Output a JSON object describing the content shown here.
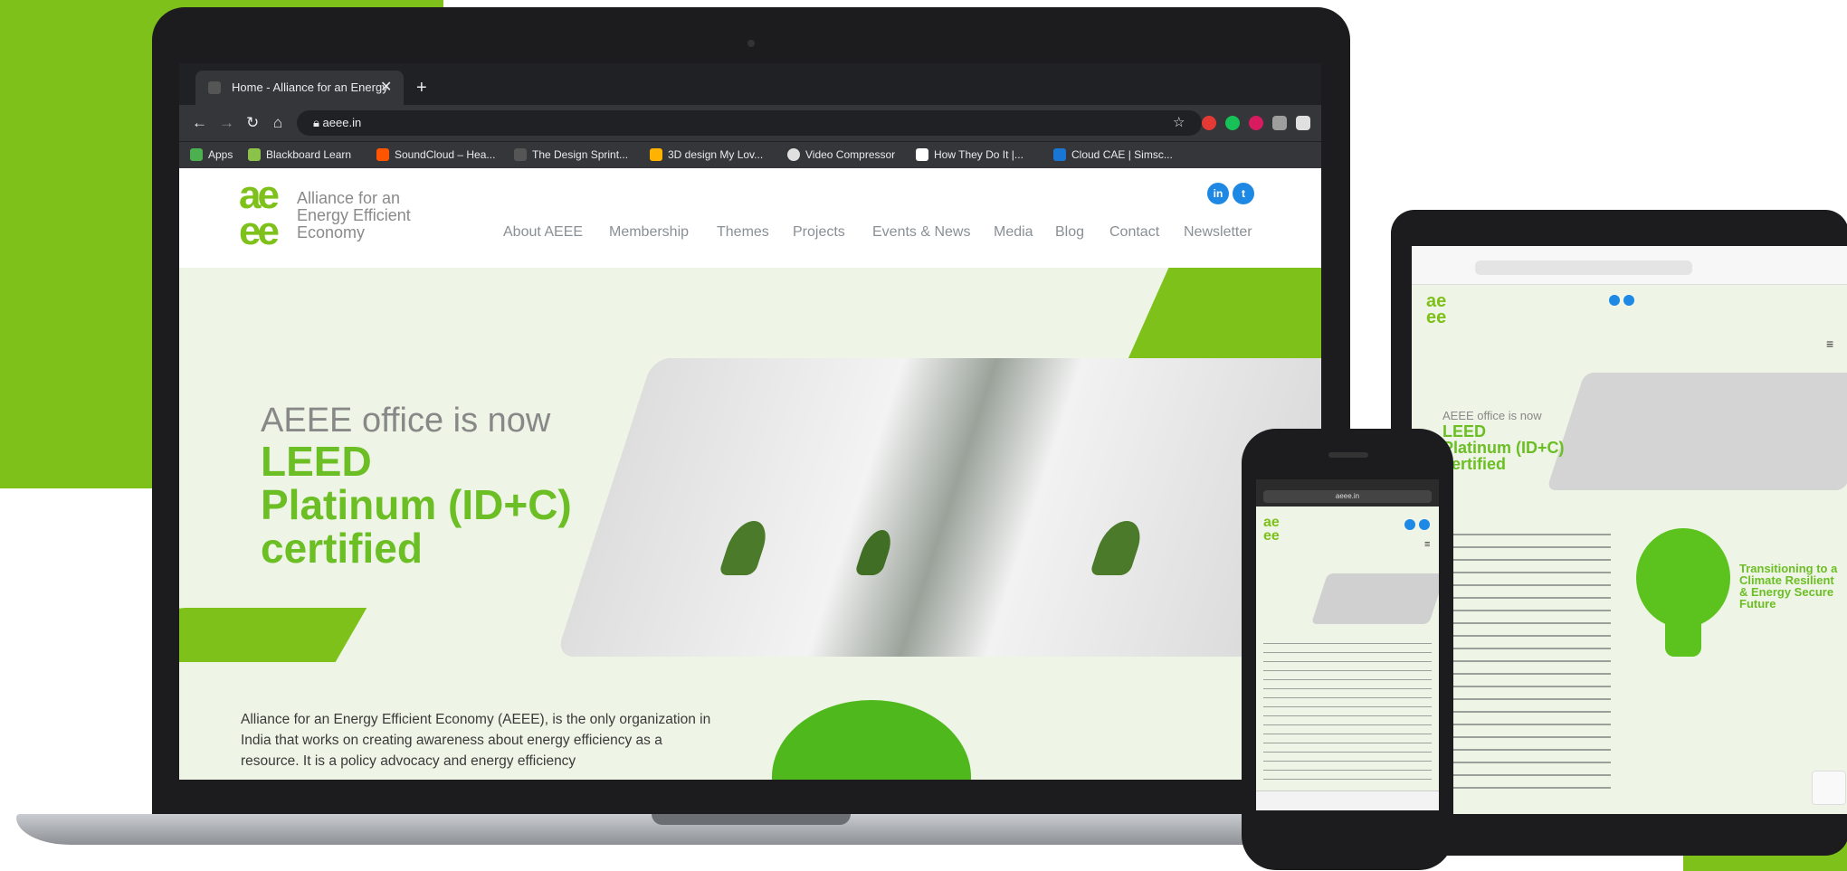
{
  "colors": {
    "brand_green": "#7ec11a",
    "heading_green": "#6cbe25",
    "chrome_dark": "#202124",
    "social_blue": "#1e88e5"
  },
  "browser": {
    "tab_title": "Home - Alliance for an Energy",
    "url": "aeee.in",
    "bookmarks": [
      "Apps",
      "Blackboard Learn",
      "SoundCloud – Hea...",
      "The Design Sprint...",
      "3D design My Lov...",
      "Video Compressor",
      "How They Do It |...",
      "Cloud CAE | Simsc..."
    ]
  },
  "site": {
    "logo_mark": "ae ee",
    "logo_text": [
      "Alliance for an",
      "Energy Efficient",
      "Economy"
    ],
    "social": [
      "in",
      "t"
    ],
    "menu": [
      "About AEEE",
      "Membership",
      "Themes",
      "Projects",
      "Events & News",
      "Media",
      "Blog",
      "Contact",
      "Newsletter"
    ],
    "hero_line1": "AEEE office is now",
    "hero_line2": "LEED",
    "hero_line3": "Platinum (ID+C)",
    "hero_line4": "certified",
    "intro": "Alliance for an Energy Efficient Economy (AEEE), is the only organization in India that works on creating awareness about energy efficiency as a resource. It is a policy advocacy and energy efficiency"
  },
  "tablet": {
    "hero_line1": "AEEE office is now",
    "hero_line2": "LEED",
    "hero_line3": "Platinum (ID+C)",
    "hero_line4": "certified",
    "bulb_text": "Transitioning to a Climate Resilient & Energy Secure Future"
  },
  "phone": {
    "url": "aeee.in"
  }
}
